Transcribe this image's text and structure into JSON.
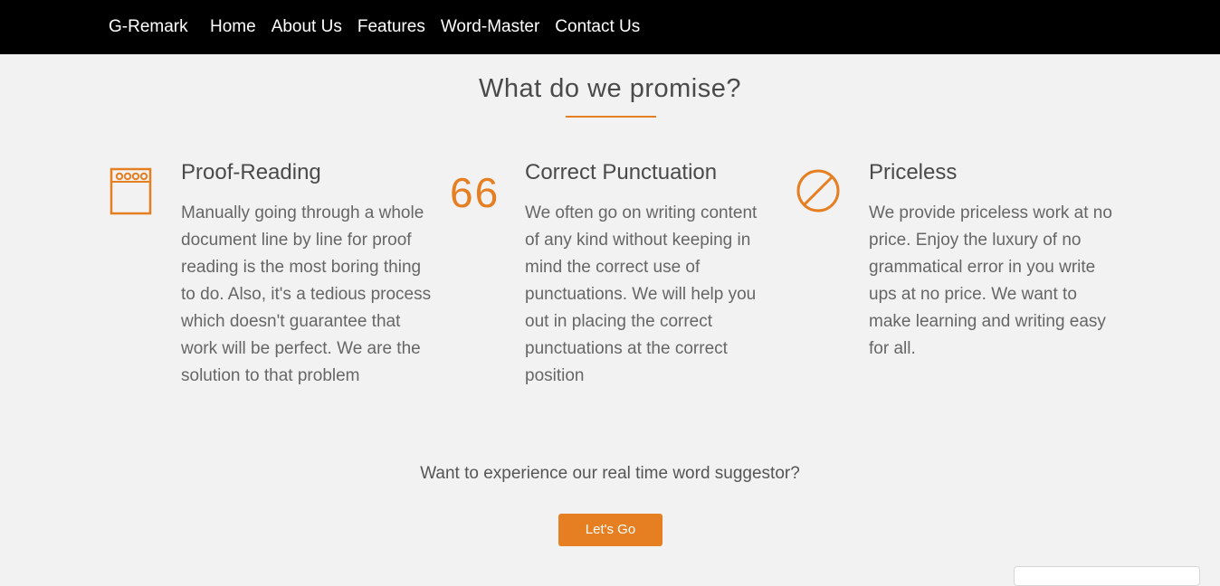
{
  "colors": {
    "accent": "#e67e22",
    "navbar_bg": "#000000",
    "page_bg": "#f2f2f2"
  },
  "navbar": {
    "brand": "G-Remark",
    "links": [
      "Home",
      "About Us",
      "Features",
      "Word-Master",
      "Contact Us"
    ]
  },
  "section": {
    "title": "What do we promise?"
  },
  "features": [
    {
      "icon": "notepad-icon",
      "title": "Proof-Reading",
      "text": "Manually going through a whole document line by line for proof reading is the most boring thing to do. Also, it's a tedious process which doesn't guarantee that work will be perfect. We are the solution to that problem"
    },
    {
      "icon": "quote-icon",
      "icon_glyph": "66",
      "title": "Correct Punctuation",
      "text": "We often go on writing content of any kind without keeping in mind the correct use of punctuations. We will help you out in placing the correct punctuations at the correct position"
    },
    {
      "icon": "prohibited-icon",
      "title": "Priceless",
      "text": "We provide priceless work at no price. Enjoy the luxury of no grammatical error in you write ups at no price. We want to make learning and writing easy for all."
    }
  ],
  "cta": {
    "prompt": "Want to experience our real time word suggestor?",
    "button_label": "Let's Go"
  }
}
